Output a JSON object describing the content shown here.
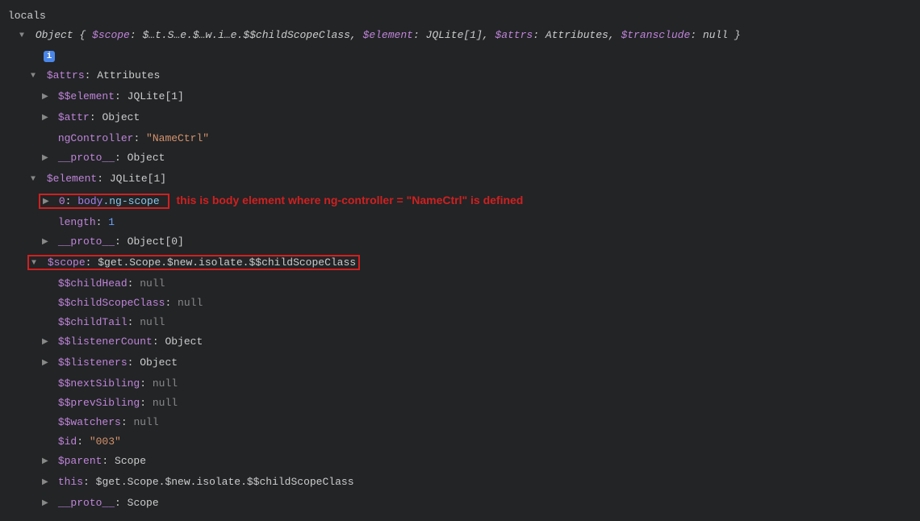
{
  "header": {
    "title": "locals",
    "summary_prefix": "Object {",
    "summary_scope_key": "$scope",
    "summary_scope_val": "$…t.S…e.$…w.i…e.$$childScopeClass",
    "summary_element_key": "$element",
    "summary_element_val": "JQLite[1]",
    "summary_attrs_key": "$attrs",
    "summary_attrs_val": "Attributes",
    "summary_transclude_key": "$transclude",
    "summary_transclude_val": "null",
    "summary_suffix": "}",
    "info_badge": "i"
  },
  "attrs_section": {
    "key": "$attrs",
    "value": "Attributes",
    "element": {
      "key": "$$element",
      "value": "JQLite[1]"
    },
    "attr": {
      "key": "$attr",
      "value": "Object"
    },
    "ngController": {
      "key": "ngController",
      "value": "\"NameCtrl\""
    },
    "proto": {
      "key": "__proto__",
      "value": "Object"
    }
  },
  "element_section": {
    "key": "$element",
    "value": "JQLite[1]",
    "zero": {
      "key": "0",
      "tag": "body",
      "cls": ".ng-scope"
    },
    "annotation": "this is body element where ng-controller = \"NameCtrl\" is defined",
    "length": {
      "key": "length",
      "value": "1"
    },
    "proto": {
      "key": "__proto__",
      "value": "Object[0]"
    }
  },
  "scope_section": {
    "key": "$scope",
    "value": "$get.Scope.$new.isolate.$$childScopeClass",
    "childHead": {
      "key": "$$childHead",
      "value": "null"
    },
    "childScopeClass": {
      "key": "$$childScopeClass",
      "value": "null"
    },
    "childTail": {
      "key": "$$childTail",
      "value": "null"
    },
    "listenerCount": {
      "key": "$$listenerCount",
      "value": "Object"
    },
    "listeners": {
      "key": "$$listeners",
      "value": "Object"
    },
    "nextSibling": {
      "key": "$$nextSibling",
      "value": "null"
    },
    "prevSibling": {
      "key": "$$prevSibling",
      "value": "null"
    },
    "watchers": {
      "key": "$$watchers",
      "value": "null"
    },
    "id": {
      "key": "$id",
      "value": "\"003\""
    },
    "parent": {
      "key": "$parent",
      "value": "Scope"
    },
    "this": {
      "key": "this",
      "value": "$get.Scope.$new.isolate.$$childScopeClass"
    },
    "proto": {
      "key": "__proto__",
      "value": "Scope"
    }
  }
}
